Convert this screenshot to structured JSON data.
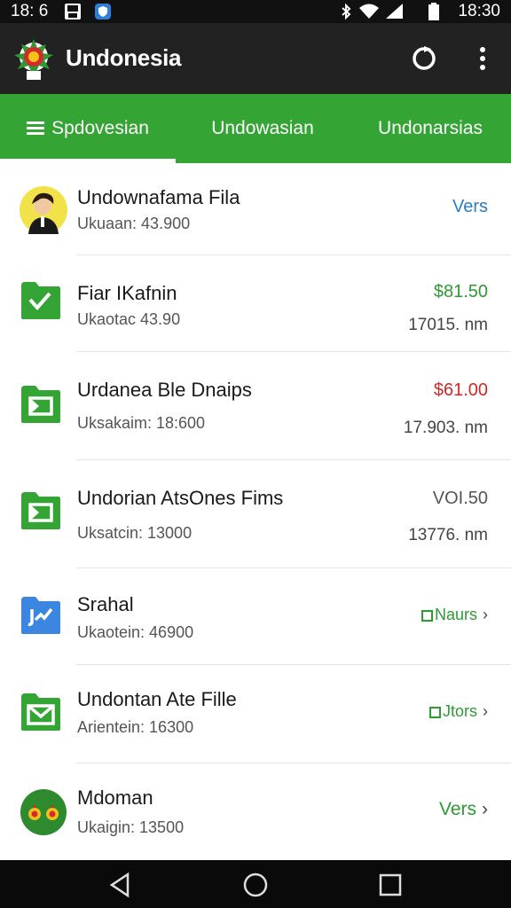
{
  "status_bar": {
    "time_left": "18: 6",
    "time_right": "18:30",
    "icons": [
      "image-icon",
      "shield-icon",
      "bluetooth-icon",
      "wifi-icon",
      "signal-icon",
      "battery-icon"
    ]
  },
  "app_bar": {
    "title": "Undonesia",
    "logo_icon": "app-logo-icon",
    "actions": [
      "refresh-icon",
      "more-vert-icon"
    ]
  },
  "tabs": [
    {
      "label": "Spdovesian",
      "active": true
    },
    {
      "label": "Undowasian",
      "active": false
    },
    {
      "label": "Undonarsias",
      "active": false
    }
  ],
  "colors": {
    "accent": "#34a535",
    "app_bar": "#222222",
    "green_text": "#2e9a34",
    "red_text": "#cc2a2a",
    "blue_text": "#2a7cc7"
  },
  "list": [
    {
      "title": "Undownafama Fila",
      "subtitle": "Ukuaan: 43.900",
      "right_top": "Vers",
      "right_bottom": "",
      "icon": "avatar-person-icon",
      "right_color": "blue"
    },
    {
      "title": "Fiar IKafnin",
      "subtitle": "Ukaotac 43.90",
      "right_top": "$81.50",
      "right_bottom": "17015. nm",
      "icon": "green-folder-check-icon",
      "right_color": "green"
    },
    {
      "title": "Urdanea Ble Dnaips",
      "subtitle": "Uksakaim: 18:600",
      "right_top": "$61.00",
      "right_bottom": "17.903. nm",
      "icon": "green-folder-icon",
      "right_color": "red"
    },
    {
      "title": "Undorian AtsOnes Fims",
      "subtitle": "Uksatcin: 13000",
      "right_top": "VOI.50",
      "right_bottom": "13776. nm",
      "icon": "green-folder-icon",
      "right_color": "gray"
    },
    {
      "title": "Srahal",
      "subtitle": "Ukaotein: 46900",
      "right_top": "Naurs",
      "right_bottom": "",
      "icon": "blue-folder-chart-icon",
      "right_color": "green",
      "chevron": true,
      "badge": true
    },
    {
      "title": "Undontan Ate Fille",
      "subtitle": "Arientein: 16300",
      "right_top": "Jtors",
      "right_bottom": "",
      "icon": "green-mail-icon",
      "right_color": "green",
      "chevron": true,
      "badge": true
    },
    {
      "title": "Mdoman",
      "subtitle": "Ukaigin: 13500",
      "right_top": "Vers",
      "right_bottom": "",
      "icon": "flower-avatar-icon",
      "right_color": "green",
      "chevron": true
    }
  ],
  "nav_bar": {
    "buttons": [
      "back-icon",
      "home-icon",
      "recents-icon"
    ]
  }
}
